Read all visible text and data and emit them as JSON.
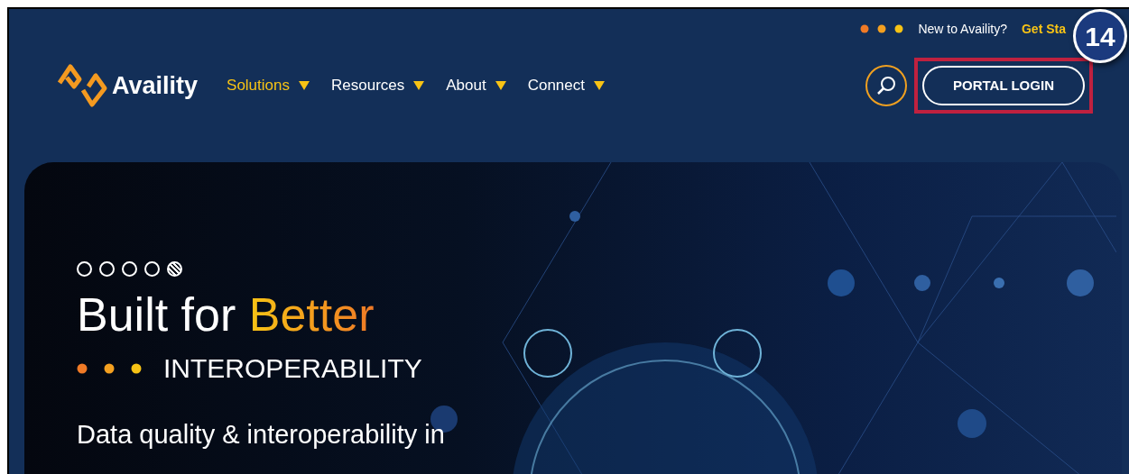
{
  "top_bar": {
    "prompt": "New to Availity?",
    "link": "Get Sta"
  },
  "logo": {
    "text": "Availity"
  },
  "nav": [
    {
      "label": "Solutions",
      "selected": true
    },
    {
      "label": "Resources",
      "selected": false
    },
    {
      "label": "About",
      "selected": false
    },
    {
      "label": "Connect",
      "selected": false
    }
  ],
  "login_button": {
    "label": "PORTAL LOGIN",
    "highlighted": true
  },
  "callout": {
    "number": "14"
  },
  "hero": {
    "slides": [
      {
        "selected": false
      },
      {
        "selected": false
      },
      {
        "selected": false
      },
      {
        "selected": false
      },
      {
        "selected": true
      }
    ],
    "title": "Built for",
    "title_highlight": "Better",
    "subtitle": "INTEROPERABILITY",
    "body": "Data quality & interoperability in"
  }
}
